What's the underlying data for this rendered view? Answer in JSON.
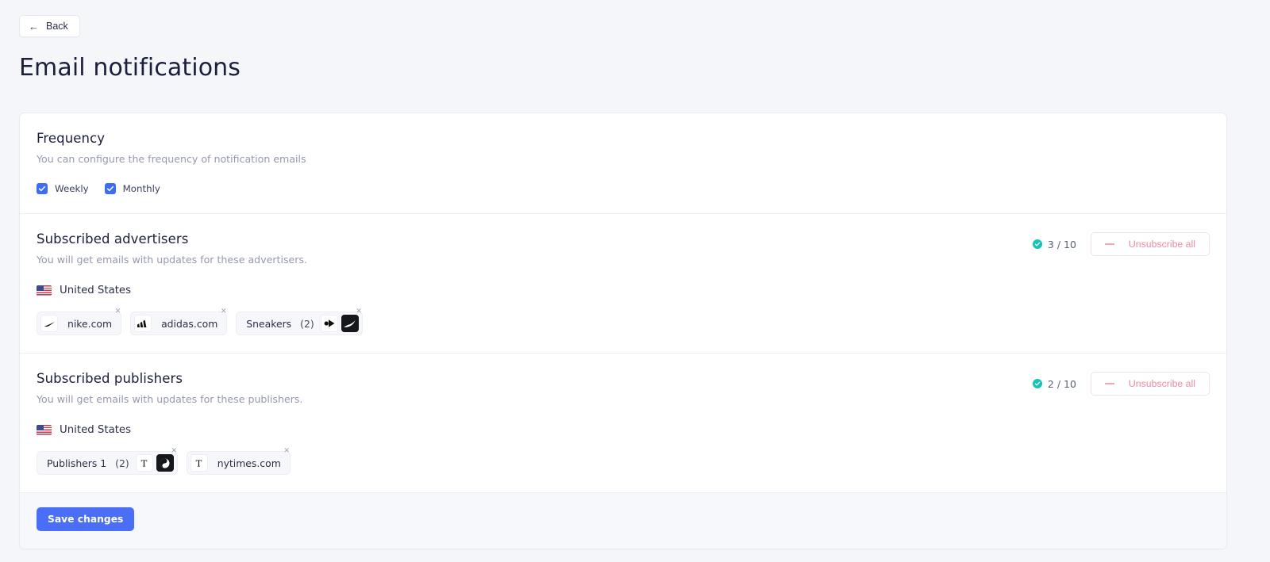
{
  "nav": {
    "back_label": "Back",
    "back_icon": "arrow-left-icon",
    "back_arrow": "←"
  },
  "page": {
    "title": "Email notifications"
  },
  "frequency": {
    "title": "Frequency",
    "subtitle": "You can configure the frequency of notification emails",
    "options": [
      {
        "label": "Weekly",
        "checked": true
      },
      {
        "label": "Monthly",
        "checked": true
      }
    ]
  },
  "advertisers": {
    "title": "Subscribed advertisers",
    "subtitle": "You will get emails with updates for these advertisers.",
    "counter": "3 / 10",
    "counter_icon": "check-circle-icon",
    "unsubscribe_label": "Unsubscribe all",
    "unsubscribe_icon": "minus-icon",
    "country": "United States",
    "country_icon": "flag-us-icon",
    "chips": [
      {
        "label": "nike.com",
        "count": "",
        "close_icon": "close-icon",
        "logos": [
          "nike-logo"
        ]
      },
      {
        "label": "adidas.com",
        "count": "",
        "close_icon": "close-icon",
        "logos": [
          "adidas-logo"
        ]
      },
      {
        "label": "Sneakers",
        "count": "(2)",
        "close_icon": "close-icon",
        "logos": [
          "arrow-badge-logo",
          "puma-logo"
        ]
      }
    ]
  },
  "publishers": {
    "title": "Subscribed publishers",
    "subtitle": "You will get emails with updates for these publishers.",
    "counter": "2 / 10",
    "counter_icon": "check-circle-icon",
    "unsubscribe_label": "Unsubscribe all",
    "unsubscribe_icon": "minus-icon",
    "country": "United States",
    "country_icon": "flag-us-icon",
    "chips": [
      {
        "label": "Publishers 1",
        "count": "(2)",
        "close_icon": "close-icon",
        "logos": [
          "nyt-logo",
          "yinyang-logo"
        ]
      },
      {
        "label": "nytimes.com",
        "count": "",
        "close_icon": "close-icon",
        "logos": [
          "nyt-logo"
        ]
      }
    ]
  },
  "footer": {
    "save_label": "Save changes"
  },
  "colors": {
    "accent": "#4a6ef5",
    "checkbox": "#3c6df5",
    "danger": "#f08a9b",
    "success": "#17c3b2",
    "page_bg": "#f4f6fa",
    "card_bg": "#ffffff"
  }
}
